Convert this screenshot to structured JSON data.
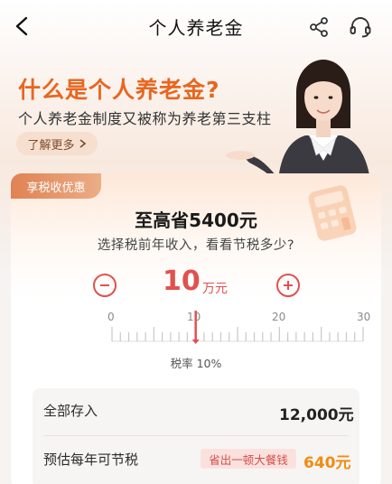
{
  "nav": {
    "title": "个人养老金"
  },
  "hero": {
    "title": "什么是个人养老金?",
    "subtitle": "个人养老金制度又被称为养老第三支柱",
    "learn_more": "了解更多"
  },
  "card": {
    "badge": "享税收优惠",
    "max_save": "至高省5400元",
    "prompt": "选择税前年收入，看看节税多少?",
    "income_value": "10",
    "income_unit": "万元",
    "ruler": {
      "min": 0,
      "max": 30,
      "labels": [
        "0",
        "10",
        "20",
        "30"
      ],
      "selected": 10
    },
    "tax_rate": "税率 10%"
  },
  "summary": {
    "deposit_label": "全部存入",
    "deposit_value": "12,000元",
    "saving_label": "预估每年可节税",
    "meal_tag": "省出一顿大餐钱",
    "saving_value": "640元"
  },
  "colors": {
    "accent_orange": "#e8661f",
    "accent_red": "#e0514e",
    "saving_orange": "#f08c10"
  }
}
